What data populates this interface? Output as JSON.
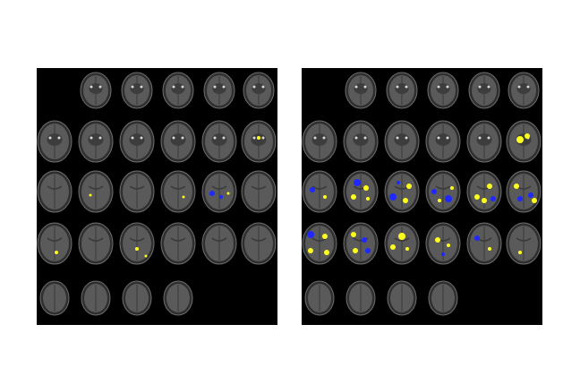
{
  "figure": {
    "background_color": "#ffffff",
    "panel_background": "#000000",
    "slice_color_outer": "#2f2f2f",
    "slice_color_inner": "#5a5a5a",
    "activation_colors": {
      "positive": "#ffff1e",
      "negative": "#1e28ff"
    },
    "layout": {
      "rows": 5,
      "columns": 6,
      "empty_slots": [
        "row1-col1",
        "row5-col5",
        "row5-col6"
      ]
    },
    "panels": [
      {
        "id": "left",
        "description_kind": "axial brain MRI slice montage with sparse activations",
        "activation_density": "sparse"
      },
      {
        "id": "right",
        "description_kind": "axial brain MRI slice montage with dense activations",
        "activation_density": "dense"
      }
    ]
  }
}
